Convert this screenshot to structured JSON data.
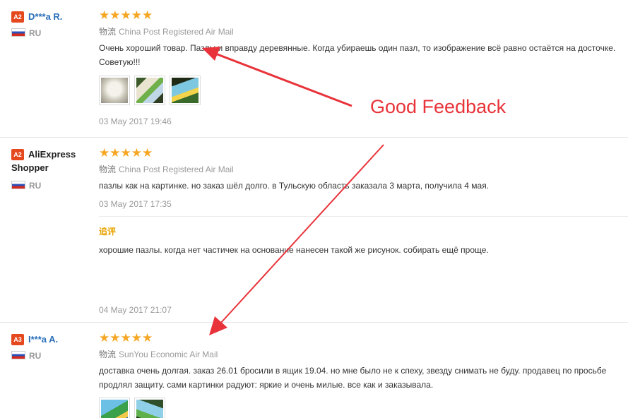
{
  "reviews": [
    {
      "level": "A2",
      "name": "D***a R.",
      "country": "RU",
      "stars": "★★★★★",
      "logistics_label": "物流",
      "logistics": "China Post Registered Air Mail",
      "text": "Очень хороший товар. Пазлы и вправду деревянные. Когда убираешь один пазл, то изображение всё равно остаётся на досточке. Советую!!!",
      "date": "03 May 2017 19:46"
    },
    {
      "level": "A2",
      "name": "AliExpress Shopper",
      "country": "RU",
      "stars": "★★★★★",
      "logistics_label": "物流",
      "logistics": "China Post Registered Air Mail",
      "text": "пазлы как на картинке. но заказ шёл долго. в Тульскую область заказала 3 марта, получила 4 мая.",
      "date": "03 May 2017 17:35",
      "followup_label": "追评",
      "followup_text": "хорошие пазлы. когда нет частичек на основание нанесен такой же рисунок. собирать ещё проще.",
      "followup_date": "04 May 2017 21:07"
    },
    {
      "level": "A3",
      "name": "I***a A.",
      "country": "RU",
      "stars": "★★★★★",
      "logistics_label": "物流",
      "logistics": "SunYou Economic Air Mail",
      "text": "доставка очень долгая. заказ 26.01 бросили в ящик 19.04. но мне было не к спеху, звезду снимать не буду. продавец по просьбе продлял защиту. сами картинки радуют: яркие и очень милые. все как и заказывала."
    }
  ],
  "annotation": {
    "text": "Good Feedback",
    "color": "#e8333a"
  },
  "colors": {
    "badge": "#e5481d",
    "star": "#f5a623",
    "link": "#2a6ebb",
    "followup": "#e8a300"
  }
}
